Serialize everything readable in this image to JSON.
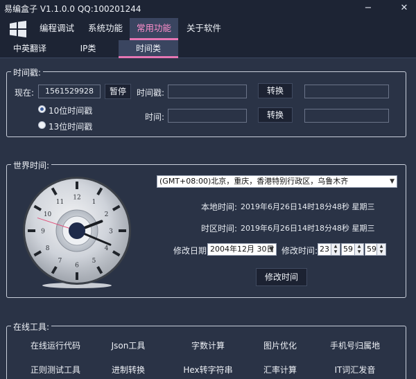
{
  "window": {
    "title": "易编盒子 V1.1.0.0 QQ:100201244",
    "minimize": "−",
    "close": "✕"
  },
  "menu": {
    "items": [
      {
        "label": "编程调试"
      },
      {
        "label": "系统功能"
      },
      {
        "label": "常用功能"
      },
      {
        "label": "关于软件"
      }
    ]
  },
  "tabs": [
    {
      "label": "中英翻译"
    },
    {
      "label": "IP类"
    },
    {
      "label": "时间类"
    }
  ],
  "timestamp": {
    "group_title": "时间戳:",
    "now_label": "现在:",
    "now_value": "1561529928",
    "pause_label": "暂停",
    "radio_10": "10位时间戳",
    "radio_13": "13位时间戳",
    "ts_label": "时间戳:",
    "time_label": "时间:",
    "convert_label": "转换",
    "convert_label2": "转换"
  },
  "world": {
    "group_title": "世界时间:",
    "timezone": "(GMT+08:00)北京，重庆，香港特别行政区，乌鲁木齐",
    "local_label": "本地时间:",
    "local_value": "2019年6月26日14时18分48秒 星期三",
    "zone_label": "时区时间:",
    "zone_value": "2019年6月26日14时18分48秒 星期三",
    "date_label": "修改日期:",
    "date_value": "2004年12月 30日",
    "time_label": "修改时间:",
    "hour": "23",
    "minute": "59",
    "second": "59",
    "modify_label": "修改时间",
    "clock_numbers": [
      "12",
      "1",
      "2",
      "3",
      "4",
      "5",
      "6",
      "7",
      "8",
      "9",
      "10",
      "11"
    ],
    "clock_hour": 2,
    "clock_minute": 18,
    "clock_second": 48
  },
  "online": {
    "group_title": "在线工具:",
    "row1": [
      "在线运行代码",
      "Json工具",
      "字数计算",
      "图片优化",
      "手机号归属地"
    ],
    "row2": [
      "正则测试工具",
      "进制转换",
      "Hex转字符串",
      "汇率计算",
      "IT词汇发音"
    ]
  }
}
